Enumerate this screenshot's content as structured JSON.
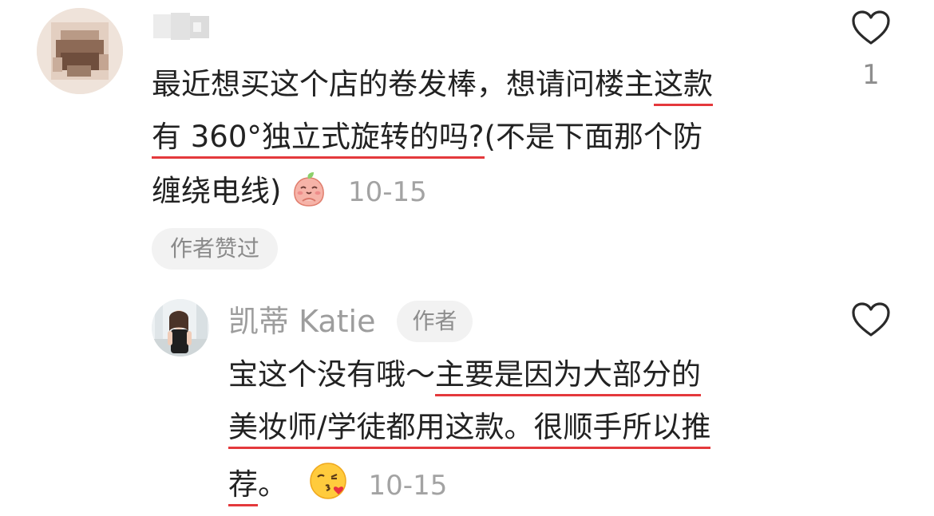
{
  "comments": [
    {
      "text_lines": [
        {
          "before": "最近想买这个店的卷发棒，想请问楼主",
          "underlined": "这款"
        },
        {
          "underlined": "有 360°独立式旋转的吗?",
          "after": "(不是下面那个防"
        },
        {
          "before": "缠绕电线)"
        }
      ],
      "time": "10-15",
      "liked_by_author_label": "作者赞过",
      "like_count": "1",
      "emoji": "peach-blush-emoji"
    },
    {
      "username": "凯蒂 Katie",
      "author_badge": "作者",
      "text_lines": [
        {
          "before": "宝这个没有哦～",
          "underlined": "主要是因为大部分的"
        },
        {
          "underlined": "美妆师/学徒都用这款。很顺手所以推"
        },
        {
          "underlined": "荐",
          "after": "。"
        }
      ],
      "time": "10-15",
      "emoji": "face-blowing-kiss-emoji"
    }
  ],
  "icons": {
    "heart": "heart-outline-icon"
  },
  "colors": {
    "underline": "#e4393c",
    "meta_text": "#a3a3a3",
    "tag_bg": "#f2f2f2"
  }
}
